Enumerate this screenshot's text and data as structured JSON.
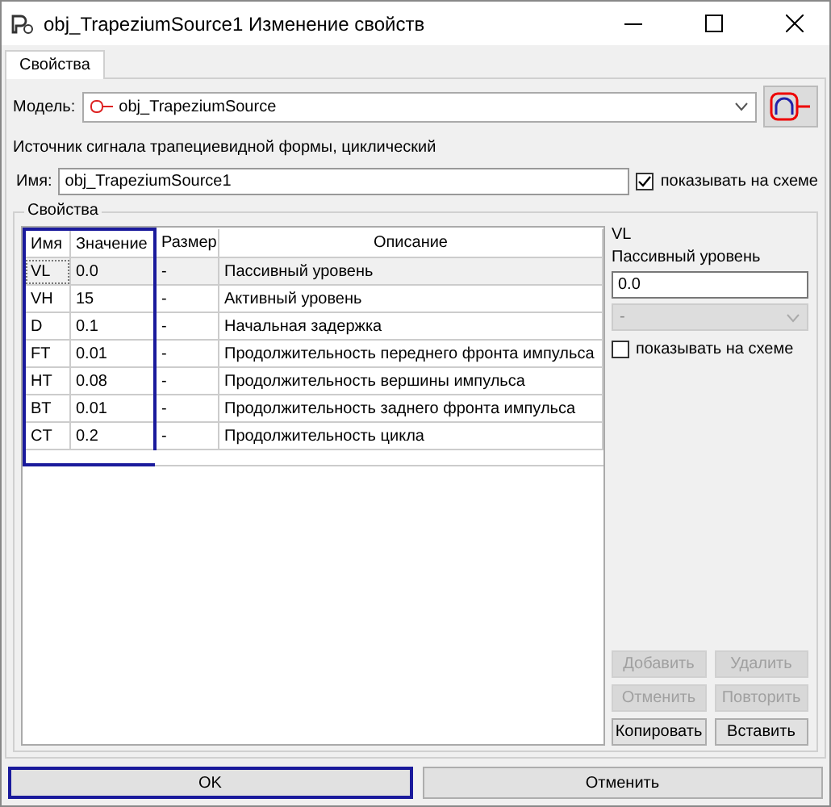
{
  "window": {
    "title": "obj_TrapeziumSource1 Изменение свойств"
  },
  "tabs": [
    {
      "label": "Свойства",
      "selected": true
    }
  ],
  "model": {
    "label": "Модель:",
    "value": "obj_TrapeziumSource"
  },
  "description": "Источник сигнала трапециевидной формы, циклический",
  "name_field": {
    "label": "Имя:",
    "value": "obj_TrapeziumSource1",
    "show_on_schema": {
      "label": "показывать на схеме",
      "checked": true
    }
  },
  "group_title": "Свойства",
  "table": {
    "columns": [
      {
        "label": "Имя",
        "highlighted": true
      },
      {
        "label": "Значение",
        "highlighted": true
      },
      {
        "label": "Размер",
        "highlighted": false
      },
      {
        "label": "Описание",
        "highlighted": false
      }
    ],
    "rows": [
      {
        "name": "VL",
        "value": "0.0",
        "size": "-",
        "description": "Пассивный уровень",
        "selected": true
      },
      {
        "name": "VH",
        "value": "15",
        "size": "-",
        "description": "Активный уровень",
        "selected": false
      },
      {
        "name": "D",
        "value": "0.1",
        "size": "-",
        "description": "Начальная задержка",
        "selected": false
      },
      {
        "name": "FT",
        "value": "0.01",
        "size": "-",
        "description": "Продолжительность переднего фронта импульса",
        "selected": false
      },
      {
        "name": "HT",
        "value": "0.08",
        "size": "-",
        "description": "Продолжительность вершины импульса",
        "selected": false
      },
      {
        "name": "BT",
        "value": "0.01",
        "size": "-",
        "description": "Продолжительность заднего фронта импульса",
        "selected": false
      },
      {
        "name": "CT",
        "value": "0.2",
        "size": "-",
        "description": "Продолжительность цикла",
        "selected": false
      }
    ]
  },
  "detail": {
    "name": "VL",
    "description": "Пассивный уровень",
    "value": "0.0",
    "unit": "-",
    "unit_disabled": true,
    "show_on_schema": {
      "label": "показывать на схеме",
      "checked": false
    }
  },
  "edit_buttons": [
    {
      "label": "Добавить",
      "disabled": true
    },
    {
      "label": "Удалить",
      "disabled": true
    },
    {
      "label": "Отменить",
      "disabled": true
    },
    {
      "label": "Повторить",
      "disabled": true
    },
    {
      "label": "Копировать",
      "disabled": false
    },
    {
      "label": "Вставить",
      "disabled": false
    }
  ],
  "dialog_buttons": [
    {
      "label": "OK",
      "highlighted": true
    },
    {
      "label": "Отменить",
      "highlighted": false
    }
  ]
}
